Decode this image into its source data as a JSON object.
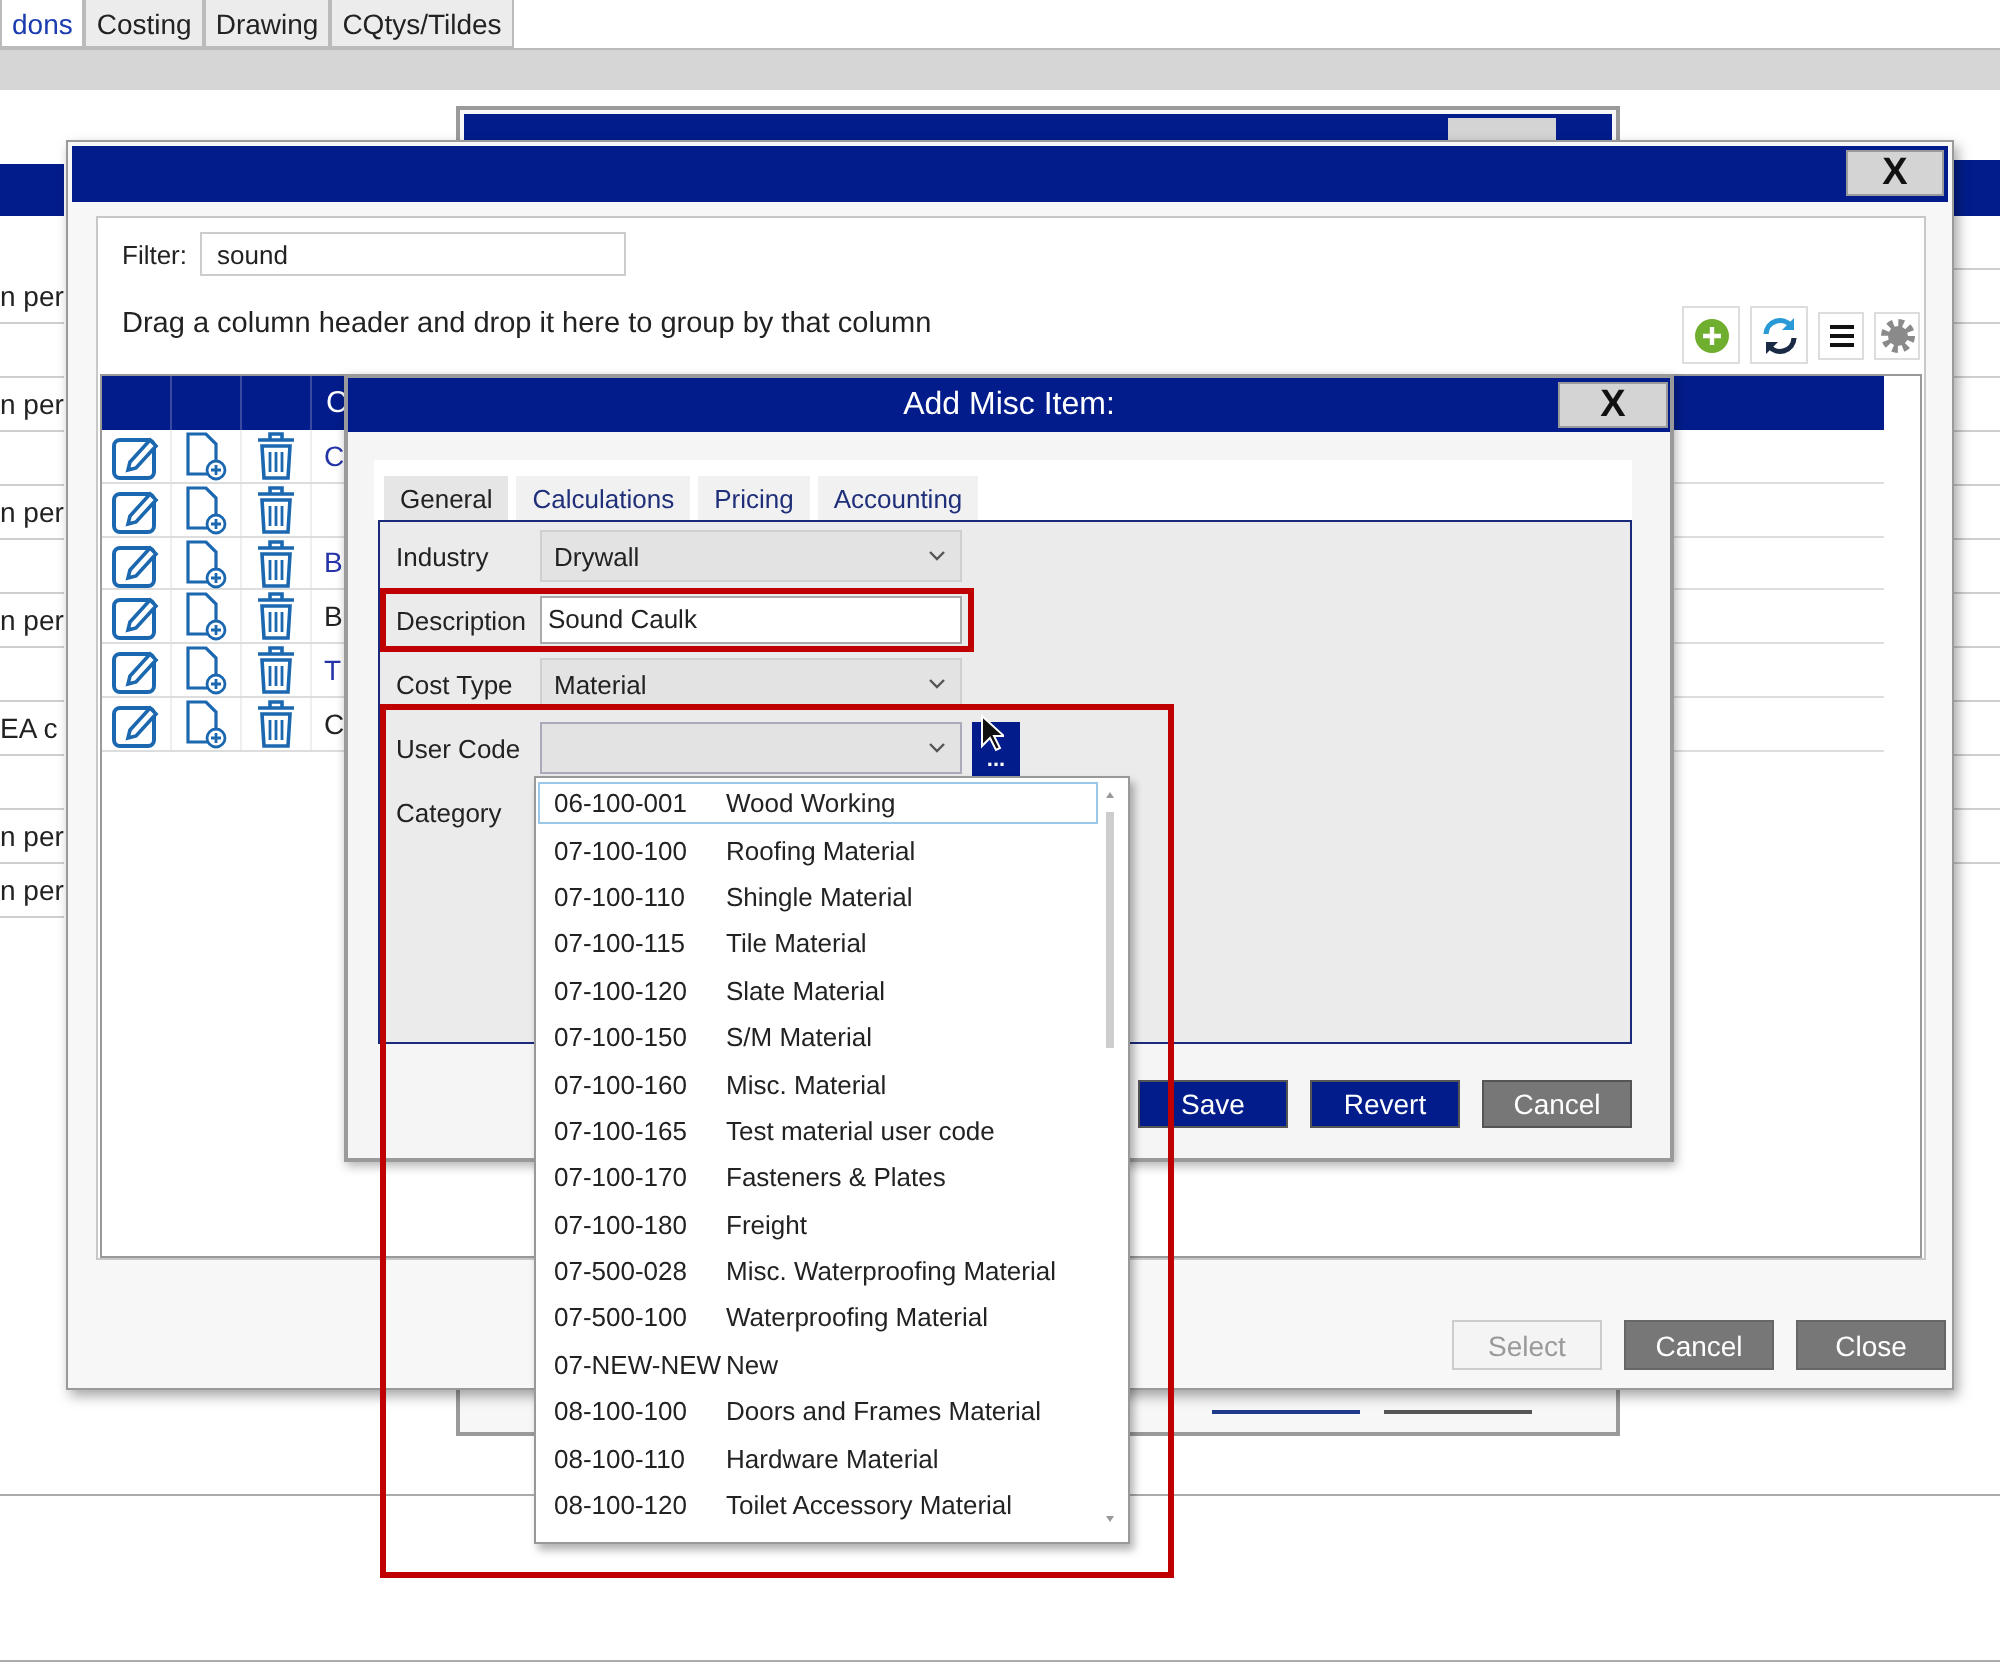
{
  "app_tabs": [
    {
      "label": "dons",
      "selected": true
    },
    {
      "label": "Costing",
      "selected": false
    },
    {
      "label": "Drawing",
      "selected": false
    },
    {
      "label": "CQtys/Tildes",
      "selected": false
    }
  ],
  "background_rows": [
    {
      "text": "n per"
    },
    {},
    {
      "text": "n per"
    },
    {},
    {
      "text": "n per"
    },
    {},
    {
      "text": "n per"
    },
    {},
    {
      "text": "EA c"
    },
    {},
    {
      "text": "n per"
    },
    {
      "text": "n per"
    }
  ],
  "picker": {
    "filter_label": "Filter:",
    "filter_value": "sound",
    "group_hint": "Drag a column header and drop it here to group by that column",
    "column_header": "C",
    "rows": [
      {
        "text": "C",
        "linked": true
      },
      {},
      {
        "text": "B",
        "linked": true
      },
      {
        "text": "B",
        "linked": false
      },
      {
        "text": "T",
        "linked": true
      },
      {
        "text": "C",
        "linked": false
      }
    ],
    "buttons": [
      {
        "label": "Select",
        "disabled": true
      },
      {
        "label": "Cancel",
        "disabled": false
      },
      {
        "label": "Close",
        "disabled": false
      }
    ]
  },
  "add_dialog": {
    "title": "Add Misc Item:",
    "close": "X",
    "tabs": [
      {
        "label": "General",
        "selected": true
      },
      {
        "label": "Calculations",
        "selected": false
      },
      {
        "label": "Pricing",
        "selected": false
      },
      {
        "label": "Accounting",
        "selected": false
      }
    ],
    "fields": [
      {
        "label": "Industry",
        "kind": "dropdown",
        "value": "Drywall",
        "highlighted": false
      },
      {
        "label": "Description",
        "kind": "text",
        "value": "Sound Caulk",
        "highlighted": true
      },
      {
        "label": "Cost Type",
        "kind": "dropdown",
        "value": "Material",
        "highlighted": false
      },
      {
        "label": "User Code",
        "kind": "browse",
        "browse_label": "...",
        "expanded": true,
        "highlighted": true
      },
      {
        "label": "Category",
        "kind": "label",
        "highlighted": false
      }
    ],
    "buttons": [
      {
        "label": "Save",
        "kind": "primary"
      },
      {
        "label": "Revert",
        "kind": "primary"
      },
      {
        "label": "Cancel",
        "kind": "secondary"
      }
    ]
  },
  "picker_close": "X",
  "user_code_options": [
    {
      "code": "06-100-001",
      "name": "Wood Working",
      "selected": true
    },
    {
      "code": "07-100-100",
      "name": "Roofing Material",
      "selected": false
    },
    {
      "code": "07-100-110",
      "name": "Shingle Material",
      "selected": false
    },
    {
      "code": "07-100-115",
      "name": "Tile Material",
      "selected": false
    },
    {
      "code": "07-100-120",
      "name": "Slate Material",
      "selected": false
    },
    {
      "code": "07-100-150",
      "name": "S/M Material",
      "selected": false
    },
    {
      "code": "07-100-160",
      "name": "Misc. Material",
      "selected": false
    },
    {
      "code": "07-100-165",
      "name": "Test material user code",
      "selected": false
    },
    {
      "code": "07-100-170",
      "name": "Fasteners & Plates",
      "selected": false
    },
    {
      "code": "07-100-180",
      "name": "Freight",
      "selected": false
    },
    {
      "code": "07-500-028",
      "name": "Misc. Waterproofing Material",
      "selected": false
    },
    {
      "code": "07-500-100",
      "name": "Waterproofing Material",
      "selected": false
    },
    {
      "code": "07-NEW-NEW",
      "name": "New",
      "selected": false
    },
    {
      "code": "08-100-100",
      "name": "Doors and Frames Material",
      "selected": false
    },
    {
      "code": "08-100-110",
      "name": "Hardware Material",
      "selected": false
    },
    {
      "code": "08-100-120",
      "name": "Toilet Accessory Material",
      "selected": false
    }
  ]
}
